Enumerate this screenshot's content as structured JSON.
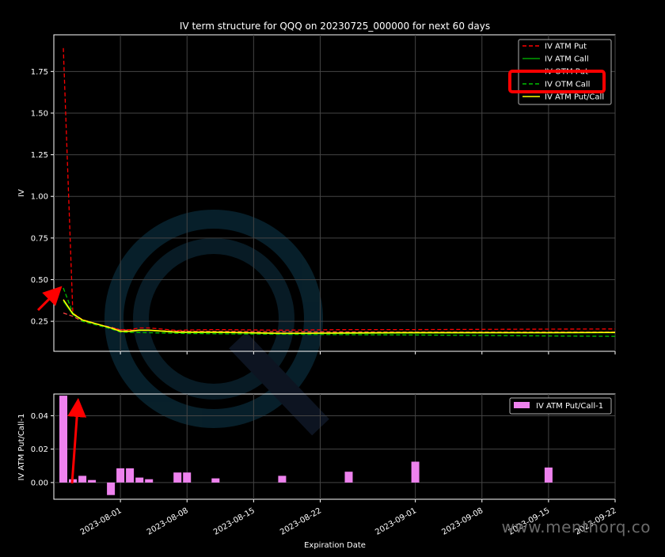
{
  "chart_data": [
    {
      "type": "line",
      "title": "IV term structure for QQQ on 20230725_000000 for next 60 days",
      "xlabel": "",
      "ylabel": "IV",
      "ylim": [
        0.07,
        1.97
      ],
      "yticks": [
        0.25,
        0.5,
        0.75,
        1.0,
        1.25,
        1.5,
        1.75
      ],
      "ytick_labels": [
        "0.25",
        "0.50",
        "0.75",
        "1.00",
        "1.25",
        "1.50",
        "1.75"
      ],
      "xlim": [
        "2023-07-25",
        "2023-09-22"
      ],
      "grid": true,
      "legend_position": "top-right",
      "series": [
        {
          "name": "IV ATM Put",
          "color": "#ff0000",
          "style": "dashed",
          "points": [
            [
              "2023-07-26",
              1.89
            ],
            [
              "2023-07-27",
              0.3
            ],
            [
              "2023-07-28",
              0.26
            ],
            [
              "2023-07-31",
              0.21
            ],
            [
              "2023-08-01",
              0.2
            ],
            [
              "2023-08-02",
              0.2
            ],
            [
              "2023-08-03",
              0.21
            ],
            [
              "2023-08-04",
              0.21
            ],
            [
              "2023-08-07",
              0.195
            ],
            [
              "2023-08-08",
              0.198
            ],
            [
              "2023-08-11",
              0.2
            ],
            [
              "2023-08-18",
              0.197
            ],
            [
              "2023-08-25",
              0.2
            ],
            [
              "2023-09-01",
              0.2
            ],
            [
              "2023-09-15",
              0.203
            ],
            [
              "2023-09-22",
              0.204
            ]
          ]
        },
        {
          "name": "IV ATM Call",
          "color": "#00a000",
          "style": "solid",
          "points": [
            [
              "2023-07-26",
              0.37
            ],
            [
              "2023-07-27",
              0.29
            ],
            [
              "2023-07-28",
              0.255
            ],
            [
              "2023-07-31",
              0.21
            ],
            [
              "2023-08-01",
              0.19
            ],
            [
              "2023-08-02",
              0.19
            ],
            [
              "2023-08-03",
              0.195
            ],
            [
              "2023-08-04",
              0.195
            ],
            [
              "2023-08-07",
              0.182
            ],
            [
              "2023-08-08",
              0.182
            ],
            [
              "2023-08-11",
              0.183
            ],
            [
              "2023-08-18",
              0.176
            ],
            [
              "2023-08-25",
              0.178
            ],
            [
              "2023-09-01",
              0.179
            ],
            [
              "2023-09-15",
              0.18
            ],
            [
              "2023-09-22",
              0.181
            ]
          ]
        },
        {
          "name": "IV OTM Put",
          "color": "#ff4040",
          "style": "dashed",
          "points": [
            [
              "2023-07-26",
              0.3
            ],
            [
              "2023-07-27",
              0.28
            ],
            [
              "2023-07-28",
              0.25
            ],
            [
              "2023-07-31",
              0.215
            ],
            [
              "2023-08-01",
              0.198
            ],
            [
              "2023-08-08",
              0.19
            ],
            [
              "2023-08-18",
              0.188
            ],
            [
              "2023-09-01",
              0.185
            ],
            [
              "2023-09-22",
              0.185
            ]
          ]
        },
        {
          "name": "IV OTM Call",
          "color": "#00c000",
          "style": "dashed",
          "points": [
            [
              "2023-07-26",
              0.45
            ],
            [
              "2023-07-27",
              0.3
            ],
            [
              "2023-07-28",
              0.25
            ],
            [
              "2023-07-31",
              0.205
            ],
            [
              "2023-08-01",
              0.185
            ],
            [
              "2023-08-08",
              0.177
            ],
            [
              "2023-08-18",
              0.172
            ],
            [
              "2023-09-01",
              0.168
            ],
            [
              "2023-09-15",
              0.162
            ],
            [
              "2023-09-22",
              0.16
            ]
          ]
        },
        {
          "name": "IV ATM Put/Call",
          "color": "#ffff00",
          "style": "solid",
          "points": [
            [
              "2023-07-26",
              0.38
            ],
            [
              "2023-07-27",
              0.295
            ],
            [
              "2023-07-28",
              0.258
            ],
            [
              "2023-07-31",
              0.21
            ],
            [
              "2023-08-01",
              0.19
            ],
            [
              "2023-08-02",
              0.19
            ],
            [
              "2023-08-03",
              0.197
            ],
            [
              "2023-08-04",
              0.197
            ],
            [
              "2023-08-07",
              0.185
            ],
            [
              "2023-08-08",
              0.185
            ],
            [
              "2023-08-11",
              0.185
            ],
            [
              "2023-08-18",
              0.178
            ],
            [
              "2023-08-25",
              0.18
            ],
            [
              "2023-09-01",
              0.182
            ],
            [
              "2023-09-15",
              0.182
            ],
            [
              "2023-09-22",
              0.183
            ]
          ]
        }
      ]
    },
    {
      "type": "bar",
      "title": "",
      "xlabel": "Expiration Date",
      "ylabel": "IV ATM Put/Call-1",
      "ylim": [
        -0.01,
        0.053
      ],
      "yticks": [
        0.0,
        0.02,
        0.04
      ],
      "ytick_labels": [
        "0.00",
        "0.02",
        "0.04"
      ],
      "xlim": [
        "2023-07-25",
        "2023-09-22"
      ],
      "xticks": [
        "2023-08-01",
        "2023-08-08",
        "2023-08-15",
        "2023-08-22",
        "2023-09-01",
        "2023-09-08",
        "2023-09-15",
        "2023-09-22"
      ],
      "grid": true,
      "legend_position": "top-right",
      "series": [
        {
          "name": "IV ATM Put/Call-1",
          "color": "#ee82ee",
          "points": [
            [
              "2023-07-26",
              0.052
            ],
            [
              "2023-07-27",
              0.002
            ],
            [
              "2023-07-28",
              0.004
            ],
            [
              "2023-07-29",
              0.0015
            ],
            [
              "2023-07-31",
              -0.0075
            ],
            [
              "2023-08-01",
              0.0085
            ],
            [
              "2023-08-02",
              0.0085
            ],
            [
              "2023-08-03",
              0.003
            ],
            [
              "2023-08-04",
              0.002
            ],
            [
              "2023-08-07",
              0.006
            ],
            [
              "2023-08-08",
              0.006
            ],
            [
              "2023-08-11",
              0.0025
            ],
            [
              "2023-08-18",
              0.004
            ],
            [
              "2023-08-25",
              0.0065
            ],
            [
              "2023-09-01",
              0.0125
            ],
            [
              "2023-09-15",
              0.009
            ]
          ]
        }
      ]
    }
  ],
  "watermark_text": "www.menthorq.co",
  "colors": {
    "background": "#000000",
    "axes": "#ffffff",
    "grid": "#505050",
    "highlight_box": "#ff0000",
    "annotation_arrow": "#ff0000",
    "logo": "#0e2a3d"
  },
  "annotation_highlight": "IV OTM Call"
}
